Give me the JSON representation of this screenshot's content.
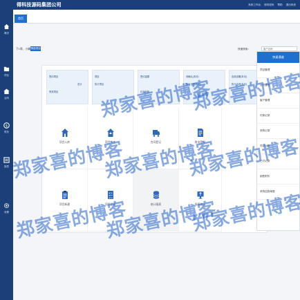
{
  "header": {
    "title": "得科技源码集团公司",
    "links": [
      "系统工作台",
      "修改密码",
      "帮助",
      "退出系统"
    ]
  },
  "sidebar": {
    "items": [
      {
        "label": "概况",
        "icon": "home-icon"
      },
      {
        "label": "项目",
        "icon": "folder-icon"
      },
      {
        "label": "合同",
        "icon": "building-icon"
      },
      {
        "label": "财务",
        "icon": "money-icon"
      },
      {
        "label": "报表",
        "icon": "report-icon"
      },
      {
        "label": "设置",
        "icon": "gear-icon"
      }
    ]
  },
  "tabs": [
    {
      "label": "首页",
      "active": true
    }
  ],
  "toolbar": {
    "filter_text": "下1周、小编",
    "filter_button": "筛选项目",
    "search_label": "快速搜索：",
    "search_placeholder": "客户名称"
  },
  "stats": [
    {
      "lines": [
        "签约项目",
        "有效项目",
        "总计"
      ]
    },
    {
      "lines": [
        "项目",
        "执行项目"
      ]
    },
    {
      "lines": [
        "签约金额",
        "约定回款"
      ]
    },
    {
      "lines": [
        "待确认(本月)",
        "执行合同(本月)"
      ]
    },
    {
      "lines": [
        "应收逾期(本月)",
        "执行合同(本月)"
      ]
    }
  ],
  "modules": [
    {
      "label": "项目入库",
      "icon": "house-icon"
    },
    {
      "label": "项目入库",
      "icon": "house-up-icon"
    },
    {
      "label": "合同登记",
      "icon": "truck-icon"
    },
    {
      "label": "财务登记",
      "icon": "document-icon"
    },
    {
      "label": "项目新建",
      "icon": "clipboard-icon"
    },
    {
      "label": "项目记录",
      "icon": "checklist-icon"
    },
    {
      "label": "统计报表",
      "icon": "database-icon"
    },
    {
      "label": "报表统计",
      "icon": "monitor-icon"
    }
  ],
  "quick_menu": {
    "title": "快速通道",
    "items": [
      "项目管理",
      "合同管理",
      "客户管理",
      "付款记录",
      "采购记录",
      "项目记录",
      "已付记录",
      "销售附件",
      "采购结算单据"
    ]
  },
  "watermark_text": "郑家喜的博客",
  "colors": {
    "header_bg": "#1b3f78",
    "accent": "#1f6fcf",
    "stat_card_bg": "#e9f1fb",
    "watermark": "#2864c8"
  }
}
